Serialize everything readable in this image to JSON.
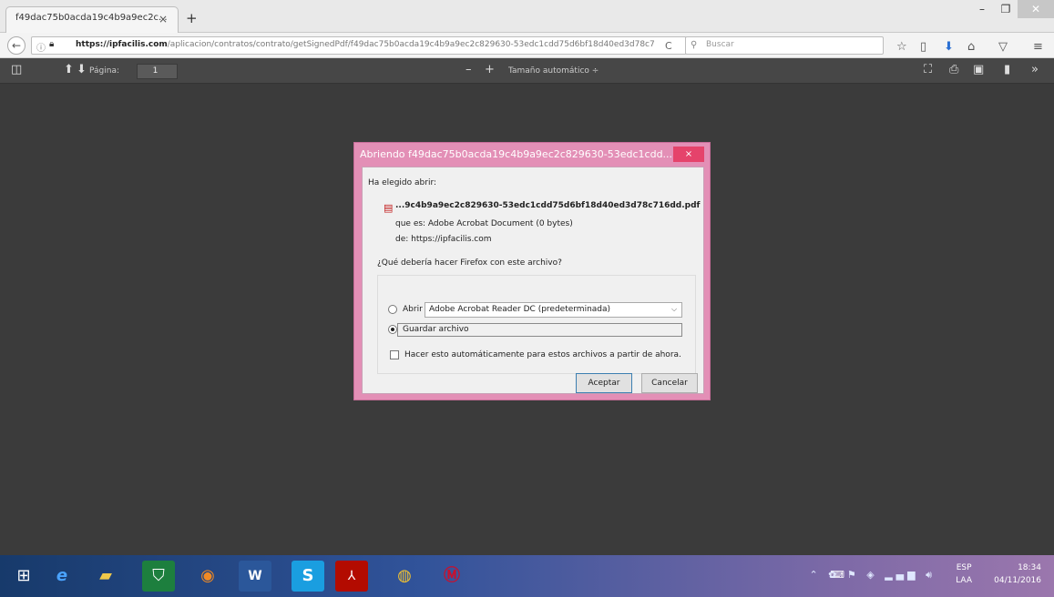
{
  "tab": {
    "title": "f49dac75b0acda19c4b9a9ec2c...",
    "close": "×",
    "new": "+"
  },
  "window_controls": {
    "minimize": "–",
    "maximize": "❐",
    "close": "✕"
  },
  "nav": {
    "back": "←",
    "url_domain": "https://ipfacilis.com",
    "url_path": "/aplicacion/contratos/contrato/getSignedPdf/f49dac75b0acda19c4b9a9ec2c829630-53edc1cdd75d6bf18d40ed3d78c7",
    "reload": "C",
    "search_placeholder": "Buscar"
  },
  "pdf_toolbar": {
    "page_label": "Página:",
    "page_value": "1",
    "zoom_out": "–",
    "zoom_in": "+",
    "zoom_value": "Tamaño automático ÷"
  },
  "dialog": {
    "title": "Abriendo f49dac75b0acda19c4b9a9ec2c829630-53edc1cdd...",
    "close": "×",
    "chosen_label": "Ha elegido abrir:",
    "filename": "...9c4b9a9ec2c829630-53edc1cdd75d6bf18d40ed3d78c716dd.pdf",
    "type_line": "que es:  Adobe Acrobat Document (0 bytes)",
    "from_line": "de:  https://ipfacilis.com",
    "question": "¿Qué debería hacer Firefox con este archivo?",
    "open_with_label": "Abrir con",
    "open_with_value": "Adobe Acrobat Reader DC  (predeterminada)",
    "save_label": "Guardar archivo",
    "auto_label": "Hacer esto automáticamente para estos archivos a partir de ahora.",
    "ok_label": "Aceptar",
    "cancel_label": "Cancelar"
  },
  "tray": {
    "lang_top": "ESP",
    "lang_bottom": "LAA",
    "time": "18:34",
    "date": "04/11/2016"
  },
  "colors": {
    "dialog_border": "#e38fb6",
    "close_red": "#e5436b",
    "viewer_bg": "#3b3b3b"
  }
}
